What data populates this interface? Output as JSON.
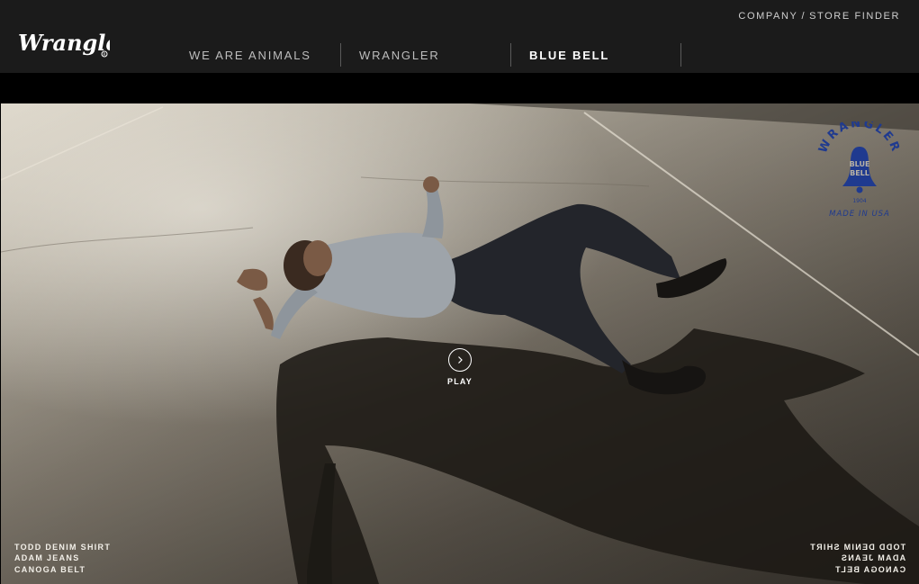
{
  "brand": {
    "name": "Wrangler",
    "logo_icon": "wrangler-script-logo"
  },
  "utility_nav": {
    "company": "COMPANY",
    "separator": "/",
    "store_finder": "STORE FINDER"
  },
  "main_nav": {
    "items": [
      {
        "label": "WE ARE ANIMALS",
        "active": false
      },
      {
        "label": "WRANGLER",
        "active": false
      },
      {
        "label": "BLUE BELL",
        "active": true
      }
    ]
  },
  "hero": {
    "play_label": "PLAY",
    "badge": {
      "top_text": "WRANGLER",
      "bell_text_1": "BLUE",
      "bell_text_2": "BELL",
      "year": "1904",
      "bottom_text": "MADE IN USA",
      "color": "#1f3a8f"
    },
    "credits_left": [
      "TODD DENIM SHIRT",
      "ADAM JEANS",
      "CANOGA BELT"
    ],
    "credits_right": [
      "TODD DENIM SHIRT",
      "ADAM JEANS",
      "CANOGA BELT"
    ]
  },
  "colors": {
    "header_bg": "#1b1b1b",
    "nav_text": "#bdbdbd",
    "nav_active": "#ffffff",
    "badge_blue": "#1f3a8f"
  }
}
